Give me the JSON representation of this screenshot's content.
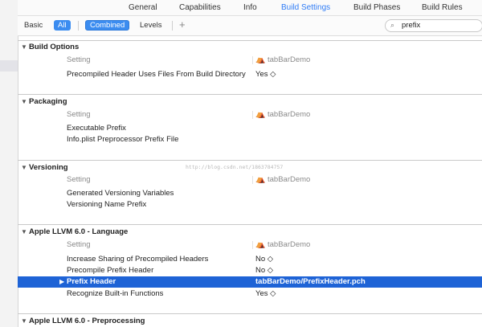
{
  "tabs": [
    "General",
    "Capabilities",
    "Info",
    "Build Settings",
    "Build Phases",
    "Build Rules"
  ],
  "filter": {
    "basic": "Basic",
    "all": "All",
    "combined": "Combined",
    "levels": "Levels",
    "plus": "+"
  },
  "search": {
    "value": "prefix",
    "icon": "magnifier-icon"
  },
  "sections": {
    "build_options": {
      "title": "Build Options",
      "setting_label": "Setting",
      "target": "tabBarDemo",
      "rows": [
        {
          "name": "Precompiled Header Uses Files From Build Directory",
          "value": "Yes ◇"
        }
      ]
    },
    "packaging": {
      "title": "Packaging",
      "setting_label": "Setting",
      "target": "tabBarDemo",
      "rows": [
        {
          "name": "Executable Prefix",
          "value": ""
        },
        {
          "name": "Info.plist Preprocessor Prefix File",
          "value": ""
        }
      ]
    },
    "versioning": {
      "title": "Versioning",
      "setting_label": "Setting",
      "target": "tabBarDemo",
      "rows": [
        {
          "name": "Generated Versioning Variables",
          "value": ""
        },
        {
          "name": "Versioning Name Prefix",
          "value": ""
        }
      ]
    },
    "llvm_language": {
      "title": "Apple LLVM 6.0 - Language",
      "setting_label": "Setting",
      "target": "tabBarDemo",
      "rows": [
        {
          "name": "Increase Sharing of Precompiled Headers",
          "value": "No ◇"
        },
        {
          "name": "Precompile Prefix Header",
          "value": "No ◇"
        },
        {
          "name": "Prefix Header",
          "value": "tabBarDemo/PrefixHeader.pch"
        },
        {
          "name": "Recognize Built-in Functions",
          "value": "Yes ◇"
        }
      ]
    },
    "llvm_preprocessing": {
      "title": "Apple LLVM 6.0 - Preprocessing"
    }
  },
  "watermark": "http://blog.csdn.net/1863784757",
  "colors": {
    "accent": "#2f7cf6",
    "selection": "#1e63d6",
    "target_icon": "#c77a2a"
  }
}
